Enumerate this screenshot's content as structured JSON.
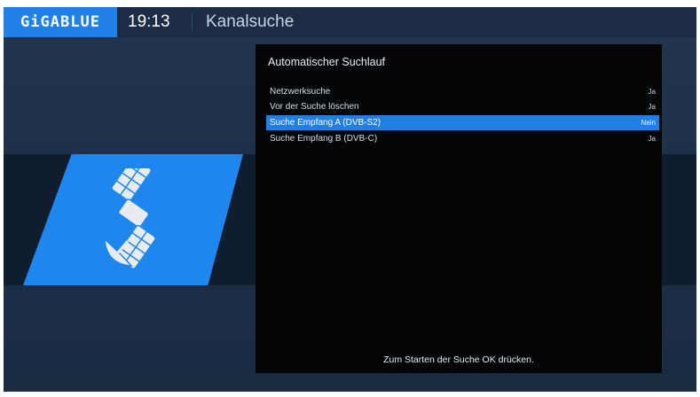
{
  "header": {
    "brand": "GiGABLUE",
    "time": "19:13",
    "title": "Kanalsuche"
  },
  "menu": {
    "title": "Automatischer Suchlauf",
    "items": [
      {
        "label": "Netzwerksuche",
        "value": "Ja",
        "selected": false
      },
      {
        "label": "Vor der Suche löschen",
        "value": "Ja",
        "selected": false
      },
      {
        "label": "Suche Empfang A (DVB-S2)",
        "value": "Nein",
        "selected": true
      },
      {
        "label": "Suche Empfang B (DVB-C)",
        "value": "Ja",
        "selected": false
      }
    ],
    "hint": "Zum Starten der Suche OK drücken."
  },
  "icons": {
    "main": "satellite-icon"
  },
  "colors": {
    "accent": "#1f7fe6",
    "background": "#1d3048",
    "panel": "#030506"
  }
}
